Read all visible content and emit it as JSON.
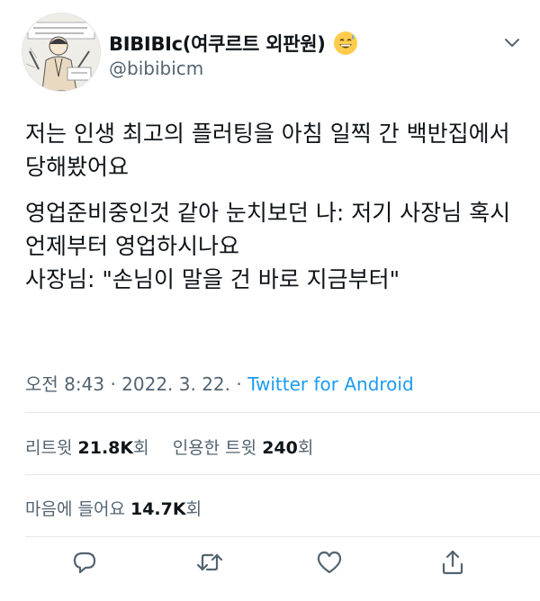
{
  "author": {
    "display_name": "BIBIBIc(여쿠르트 외판원)",
    "emoji": "grinning-face-with-sweat-icon",
    "handle": "@bibibicm"
  },
  "tweet": {
    "paragraphs": [
      "저는 인생 최고의 플러팅을 아침 일찍 간 백반집에서 당해봤어요",
      "영업준비중인것 같아 눈치보던 나: 저기 사장님 혹시 언제부터 영업하시나요\n사장님: \"손님이 말을 건 바로 지금부터\""
    ]
  },
  "meta": {
    "time": "오전 8:43",
    "separator": "·",
    "date": "2022. 3. 22.",
    "source": "Twitter for Android"
  },
  "stats": {
    "retweets_label": "리트윗",
    "retweets_count": "21.8K",
    "retweets_unit": "회",
    "quotes_label": "인용한 트윗",
    "quotes_count": "240",
    "quotes_unit": "회",
    "likes_label": "마음에 들어요",
    "likes_count": "14.7K",
    "likes_unit": "회"
  },
  "actions": [
    "reply-icon",
    "retweet-icon",
    "like-icon",
    "share-icon"
  ],
  "colors": {
    "accent": "#1d9bf0",
    "secondary_text": "#536471",
    "primary_text": "#0f1419"
  }
}
